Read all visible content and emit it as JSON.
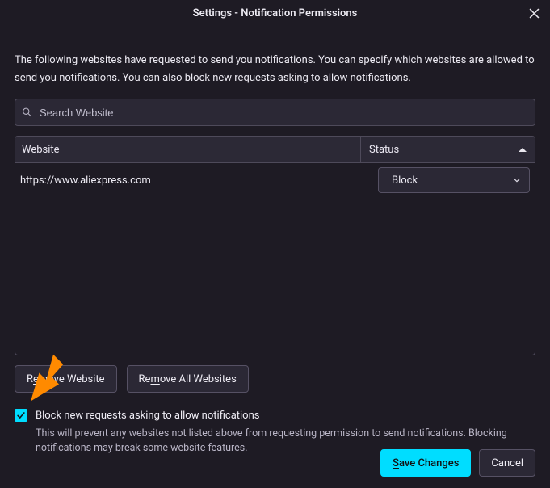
{
  "window": {
    "title": "Settings - Notification Permissions"
  },
  "description": "The following websites have requested to send you notifications. You can specify which websites are allowed to send you notifications. You can also block new requests asking to allow notifications.",
  "search": {
    "placeholder": "Search Website"
  },
  "table": {
    "headers": {
      "website": "Website",
      "status": "Status"
    },
    "rows": [
      {
        "website": "https://www.aliexpress.com",
        "status": "Block"
      }
    ]
  },
  "buttons": {
    "remove_website_prefix": "R",
    "remove_website_ul": "e",
    "remove_website_suffix": "move Website",
    "remove_all_prefix": "Re",
    "remove_all_ul": "m",
    "remove_all_suffix": "ove All Websites",
    "save_ul": "S",
    "save_suffix": "ave Changes",
    "cancel": "Cancel"
  },
  "checkbox": {
    "label": "Block new requests asking to allow notifications",
    "help": "This will prevent any websites not listed above from requesting permission to send notifications. Blocking notifications may break some website features."
  }
}
